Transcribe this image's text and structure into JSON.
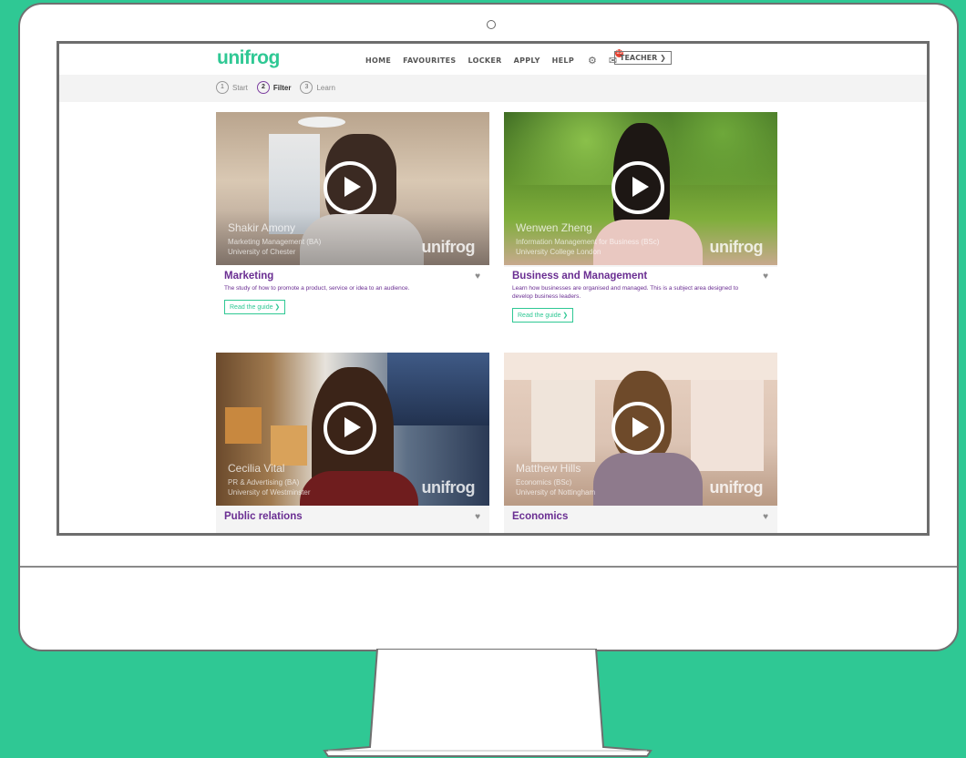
{
  "header": {
    "logo": "unifrog",
    "nav": [
      "HOME",
      "FAVOURITES",
      "LOCKER",
      "APPLY",
      "HELP"
    ],
    "notifications": "13",
    "teacher_label": "TEACHER ❯"
  },
  "steps": [
    {
      "num": "1",
      "label": "Start"
    },
    {
      "num": "2",
      "label": "Filter"
    },
    {
      "num": "3",
      "label": "Learn"
    }
  ],
  "cards": [
    {
      "title": "Marketing",
      "description": "The study of how to promote a product, service or idea to an audience.",
      "button": "Read the guide ❯",
      "video_name": "Shakir Amony",
      "video_course": "Marketing Management (BA)",
      "video_uni": "University of Chester",
      "watermark": "unifrog"
    },
    {
      "title": "Business and Management",
      "description": "Learn how businesses are organised and managed. This is a subject area designed to develop business leaders.",
      "button": "Read the guide ❯",
      "video_name": "Wenwen Zheng",
      "video_course": "Information Management for Business (BSc)",
      "video_uni": "University College London",
      "watermark": "unifrog"
    },
    {
      "title": "Public relations",
      "video_name": "Cecilia Vital",
      "video_course": "PR & Advertising (BA)",
      "video_uni": "University of Westminster",
      "watermark": "unifrog"
    },
    {
      "title": "Economics",
      "video_name": "Matthew Hills",
      "video_course": "Economics (BSc)",
      "video_uni": "University of Nottingham",
      "watermark": "unifrog"
    }
  ],
  "colors": {
    "background": "#2fc894",
    "accent": "#2fc894",
    "title": "#6a2e92"
  }
}
